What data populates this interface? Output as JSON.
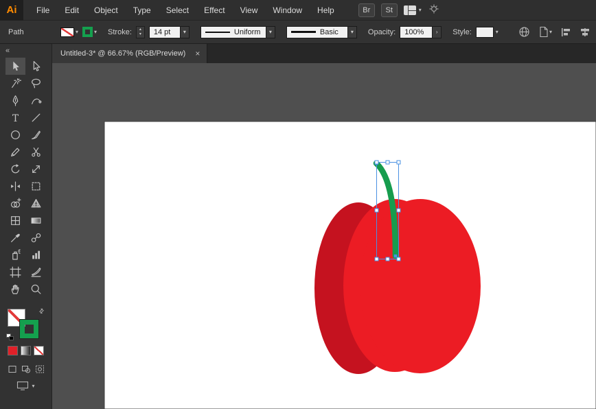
{
  "menubar": {
    "logo": "Ai",
    "items": [
      "File",
      "Edit",
      "Object",
      "Type",
      "Select",
      "Effect",
      "View",
      "Window",
      "Help"
    ],
    "br_button": "Br",
    "st_button": "St"
  },
  "controlbar": {
    "context": "Path",
    "stroke_label": "Stroke:",
    "stroke_value": "14 pt",
    "width_profile_value": "Uniform",
    "brush_value": "Basic",
    "opacity_label": "Opacity:",
    "opacity_value": "100%",
    "style_label": "Style:"
  },
  "document_tab": {
    "title": "Untitled-3* @ 66.67% (RGB/Preview)"
  },
  "toolbar": {
    "tools": [
      "selection",
      "direct-selection",
      "magic-wand",
      "lasso",
      "pen",
      "curvature",
      "type",
      "line-segment",
      "ellipse",
      "paintbrush",
      "pencil",
      "scissors",
      "rotate",
      "scale",
      "width",
      "free-transform",
      "shape-builder",
      "perspective-grid",
      "mesh",
      "gradient",
      "eyedropper",
      "blend",
      "symbol-sprayer",
      "column-graph",
      "artboard",
      "slice",
      "hand",
      "zoom"
    ],
    "active_tool": "selection"
  },
  "icons": {
    "chevron_down": "▾",
    "chevron_up": "▴",
    "flyout": "›",
    "close": "×",
    "collapse": "«",
    "swap": "⇄"
  },
  "artwork": {
    "apple_red": "#EC1C24",
    "apple_shadow_red": "#C5121F",
    "stem_green": "#169C4E",
    "selection_blue": "#4A90E2",
    "artboard_color": "#FFFFFF",
    "canvas_color": "#4F4F4F"
  }
}
